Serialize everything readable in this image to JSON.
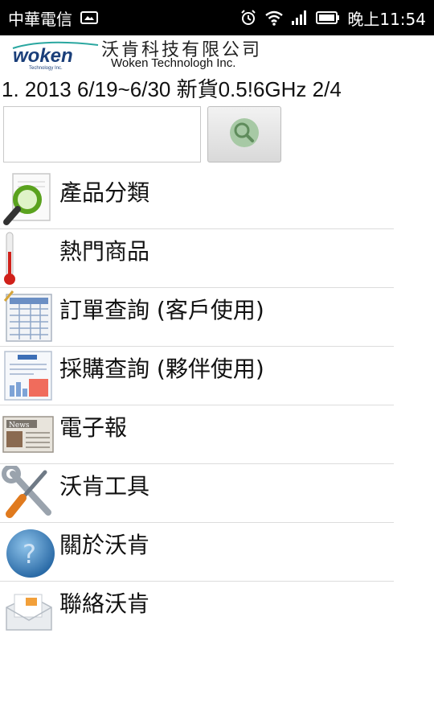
{
  "status_bar": {
    "carrier": "中華電信",
    "time": "晚上11:54"
  },
  "header": {
    "logo_text": "woken",
    "logo_subtext": "Technology Inc.",
    "company_zh": "沃肯科技有限公司",
    "company_en": "Woken Technologh Inc."
  },
  "marquee": {
    "text": "1. 2013 6/19~6/30 新貨0.5!6GHz 2/4"
  },
  "search": {
    "value": "",
    "placeholder": ""
  },
  "menu": {
    "items": [
      {
        "label": "產品分類",
        "icon": "magnifier-document-icon"
      },
      {
        "label": "熱門商品",
        "icon": "thermometer-icon"
      },
      {
        "label": "訂單查詢 (客戶使用)",
        "icon": "spreadsheet-icon"
      },
      {
        "label": "採購查詢 (夥伴使用)",
        "icon": "report-chart-icon"
      },
      {
        "label": "電子報",
        "icon": "newspaper-icon"
      },
      {
        "label": "沃肯工具",
        "icon": "tools-icon"
      },
      {
        "label": "關於沃肯",
        "icon": "question-globe-icon"
      },
      {
        "label": "聯絡沃肯",
        "icon": "mail-envelope-icon"
      }
    ]
  }
}
